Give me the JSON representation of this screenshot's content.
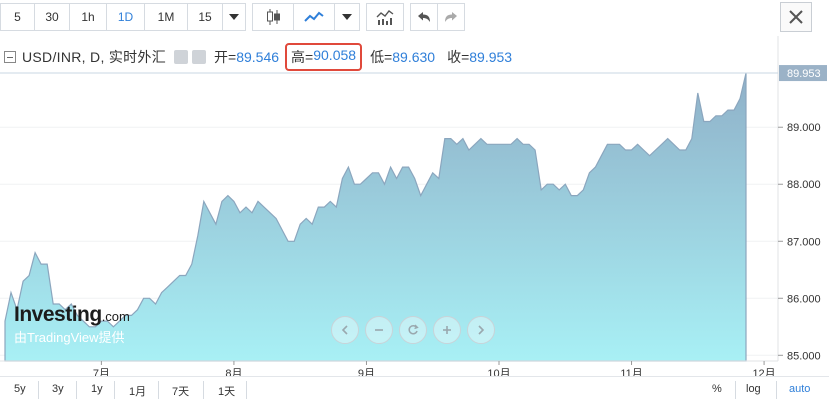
{
  "toolbar": {
    "intervals": [
      "5",
      "30",
      "1h",
      "1D",
      "1M",
      "15"
    ],
    "active_interval": "1D",
    "colors": {
      "active": "#2f7fd9"
    }
  },
  "legend": {
    "symbol": "USD/INR, D, 实时外汇",
    "open_label": "开=",
    "open_value": "89.546",
    "high_label": "高=",
    "high_value": "90.058",
    "low_label": "低=",
    "low_value": "89.630",
    "close_label": "收=",
    "close_value": "89.953"
  },
  "watermark": {
    "brand": "Investing",
    "domain": ".com",
    "sub": "由TradingView提供"
  },
  "bottom": {
    "ranges": [
      "5y",
      "3y",
      "1y",
      "1月",
      "7天",
      "1天"
    ],
    "percent": "%",
    "log": "log",
    "auto": "auto"
  },
  "chart_data": {
    "type": "area",
    "ylim": [
      84.9,
      90.6
    ],
    "yticks": [
      "85.000",
      "86.000",
      "87.000",
      "88.000",
      "89.000"
    ],
    "last_value_label": "89.953",
    "x_labels": [
      "7月",
      "8月",
      "9月",
      "10月",
      "11月",
      "12月"
    ],
    "x_label_index": [
      16,
      38,
      60,
      82,
      104,
      126
    ],
    "values": [
      85.6,
      86.1,
      85.8,
      86.3,
      86.4,
      86.8,
      86.6,
      86.6,
      85.9,
      85.9,
      85.8,
      85.9,
      85.7,
      85.6,
      85.5,
      85.5,
      85.6,
      85.6,
      85.5,
      85.6,
      85.7,
      85.7,
      85.8,
      86.0,
      86.0,
      85.9,
      86.1,
      86.2,
      86.3,
      86.4,
      86.4,
      86.6,
      87.1,
      87.7,
      87.5,
      87.3,
      87.7,
      87.8,
      87.7,
      87.5,
      87.6,
      87.5,
      87.7,
      87.6,
      87.5,
      87.4,
      87.2,
      87.0,
      87.0,
      87.3,
      87.4,
      87.3,
      87.6,
      87.6,
      87.7,
      87.6,
      88.1,
      88.3,
      88.0,
      88.0,
      88.1,
      88.2,
      88.2,
      88.0,
      88.3,
      88.1,
      88.3,
      88.3,
      88.1,
      87.8,
      88.0,
      88.2,
      88.1,
      88.8,
      88.8,
      88.7,
      88.8,
      88.6,
      88.7,
      88.8,
      88.7,
      88.7,
      88.7,
      88.7,
      88.7,
      88.8,
      88.7,
      88.7,
      88.6,
      87.9,
      88.0,
      88.0,
      87.9,
      88.0,
      87.8,
      87.8,
      87.9,
      88.2,
      88.3,
      88.5,
      88.7,
      88.7,
      88.7,
      88.6,
      88.6,
      88.7,
      88.6,
      88.5,
      88.6,
      88.7,
      88.8,
      88.7,
      88.6,
      88.6,
      88.8,
      89.6,
      89.1,
      89.1,
      89.2,
      89.2,
      89.3,
      89.3,
      89.5,
      89.95
    ],
    "colors": {
      "fill_top": "#8fb0c8",
      "fill_bottom": "#a8f0f5",
      "line": "#8ba6be",
      "price_label_bg": "#9bb2c7"
    }
  }
}
